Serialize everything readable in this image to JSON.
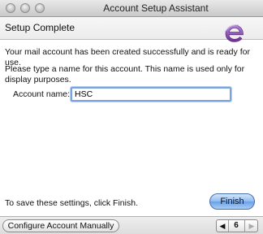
{
  "window": {
    "title": "Account Setup Assistant"
  },
  "header": {
    "title": "Setup Complete"
  },
  "body": {
    "success_message": "Your mail account has been created successfully and is ready for use.",
    "name_prompt": "Please type a name for this account. This name is used only for display purposes.",
    "account_name_label": "Account name:",
    "account_name_value": "HSC",
    "save_hint": "To save these settings, click Finish."
  },
  "buttons": {
    "finish": "Finish",
    "configure_manually": "Configure Account Manually"
  },
  "pager": {
    "prev_icon": "◀",
    "page": "6",
    "next_icon": "▶"
  },
  "colors": {
    "logo_purple": "#7b3fa0",
    "focus_ring": "#7aa3e2",
    "finish_blue": "#8fbaf0"
  },
  "icons": {
    "logo": "entourage-e-logo"
  }
}
